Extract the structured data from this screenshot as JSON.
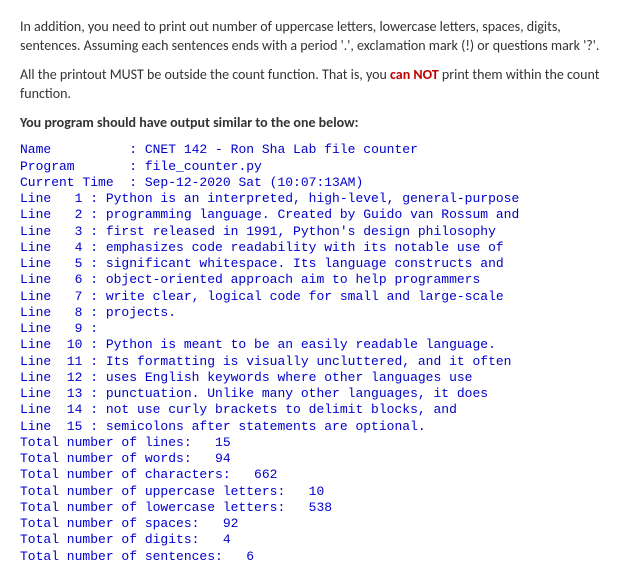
{
  "instructions": {
    "p1": "In addition, you need to print out number of uppercase letters, lowercase letters, spaces, digits, sentences.  Assuming each sentences ends with a period '.', exclamation mark (!) or questions mark '?'.",
    "p2_before": "All the printout MUST be outside the count function.  That is, you ",
    "p2_red": "can NOT",
    "p2_after": " print them within the count function.",
    "p3": "You program should have output similar to the one below:"
  },
  "output": {
    "header": {
      "name_label": "Name          : ",
      "name_value": "CNET 142 - Ron Sha Lab file counter",
      "program_label": "Program       : ",
      "program_value": "file_counter.py",
      "time_label": "Current Time  : ",
      "time_value": "Sep-12-2020 Sat (10:07:13AM)"
    },
    "lines": [
      {
        "n": " 1",
        "t": "Python is an interpreted, high-level, general-purpose"
      },
      {
        "n": " 2",
        "t": "programming language. Created by Guido van Rossum and"
      },
      {
        "n": " 3",
        "t": "first released in 1991, Python's design philosophy"
      },
      {
        "n": " 4",
        "t": "emphasizes code readability with its notable use of"
      },
      {
        "n": " 5",
        "t": "significant whitespace. Its language constructs and"
      },
      {
        "n": " 6",
        "t": "object-oriented approach aim to help programmers"
      },
      {
        "n": " 7",
        "t": "write clear, logical code for small and large-scale"
      },
      {
        "n": " 8",
        "t": "projects."
      },
      {
        "n": " 9",
        "t": ""
      },
      {
        "n": "10",
        "t": "Python is meant to be an easily readable language."
      },
      {
        "n": "11",
        "t": "Its formatting is visually uncluttered, and it often"
      },
      {
        "n": "12",
        "t": "uses English keywords where other languages use"
      },
      {
        "n": "13",
        "t": "punctuation. Unlike many other languages, it does"
      },
      {
        "n": "14",
        "t": "not use curly brackets to delimit blocks, and"
      },
      {
        "n": "15",
        "t": "semicolons after statements are optional."
      }
    ],
    "totals": {
      "lines": "Total number of lines:   15",
      "words": "Total number of words:   94",
      "chars": "Total number of characters:   662",
      "upper": "Total number of uppercase letters:   10",
      "lower": "Total number of lowercase letters:   538",
      "spaces": "Total number of spaces:   92",
      "digits": "Total number of digits:   4",
      "sentences": "Total number of sentences:   6"
    }
  }
}
